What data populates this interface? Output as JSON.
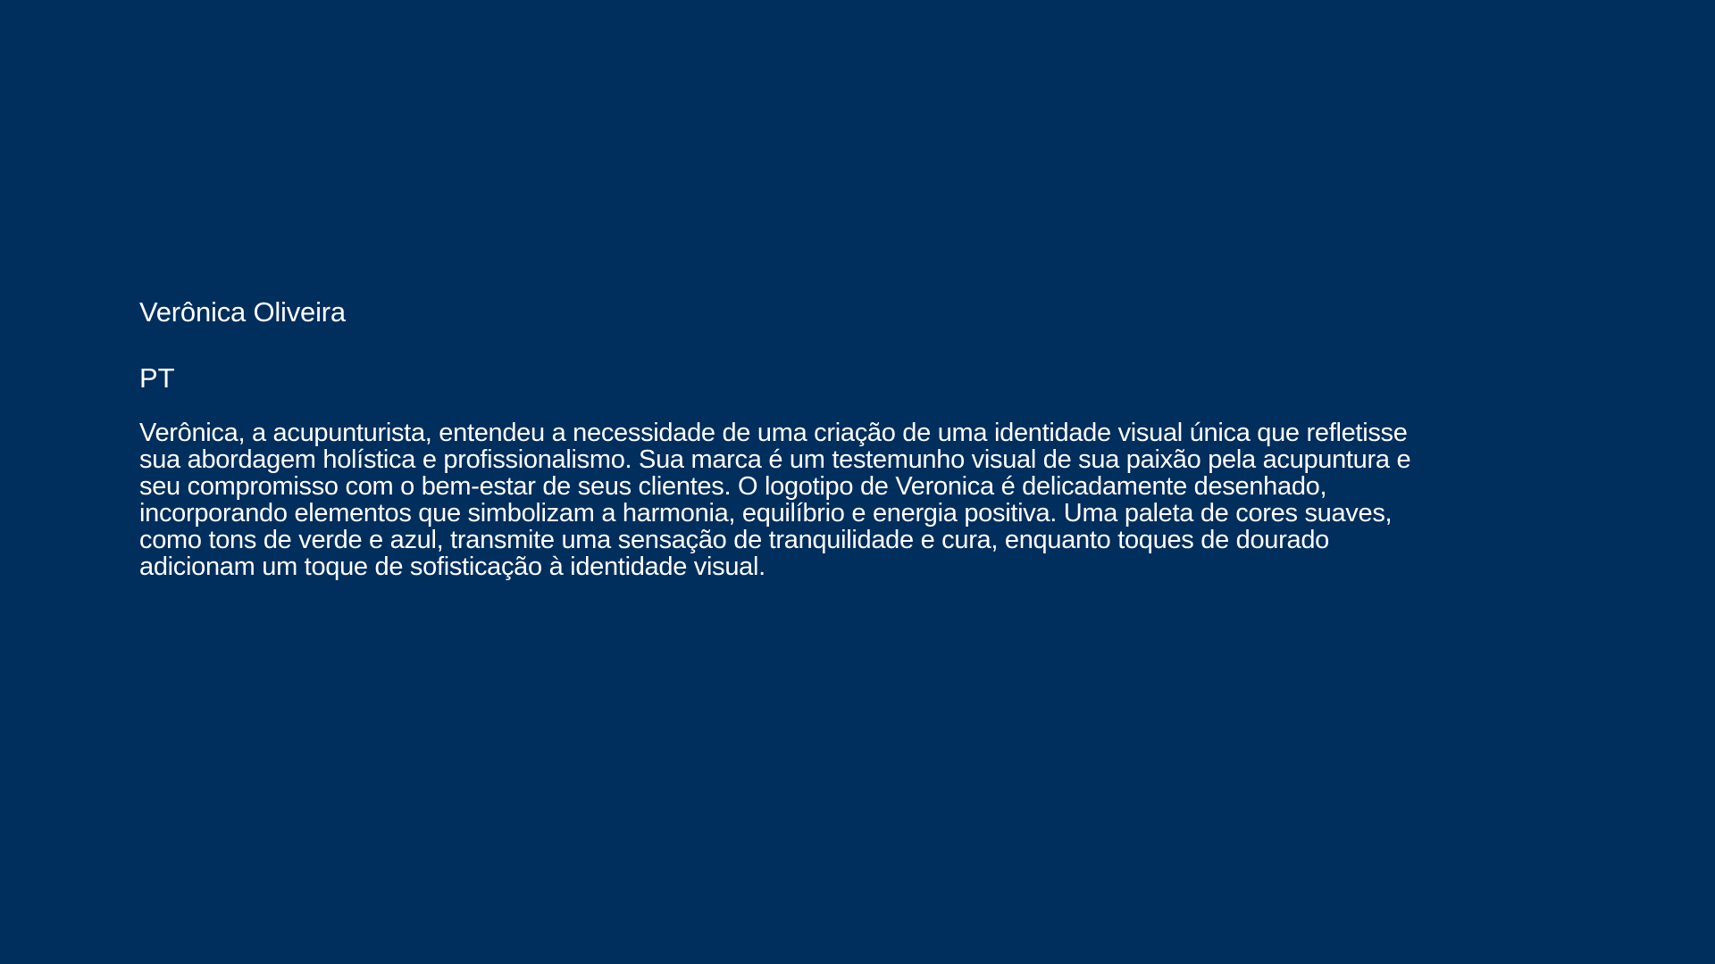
{
  "colors": {
    "background": "#002e5d",
    "text": "#ffffff"
  },
  "profile": {
    "name": "Verônica Oliveira",
    "language": "PT",
    "description": "Verônica, a acupunturista, entendeu a necessidade de uma criação de uma identidade visual única que refletisse\nsua abordagem holística e profissionalismo. Sua marca é um testemunho visual de sua paixão pela  acupuntura e\nseu compromisso com o bem-estar de seus clientes. O logotipo de Veronica é delicadamente desenhado,\nincorporando elementos que simbolizam a harmonia, equilíbrio e energia positiva. Uma paleta de cores suaves,\ncomo tons de verde e azul, transmite uma sensação de tranquilidade e cura, enquanto toques de dourado\nadicionam um toque de sofisticação à identidade visual."
  }
}
